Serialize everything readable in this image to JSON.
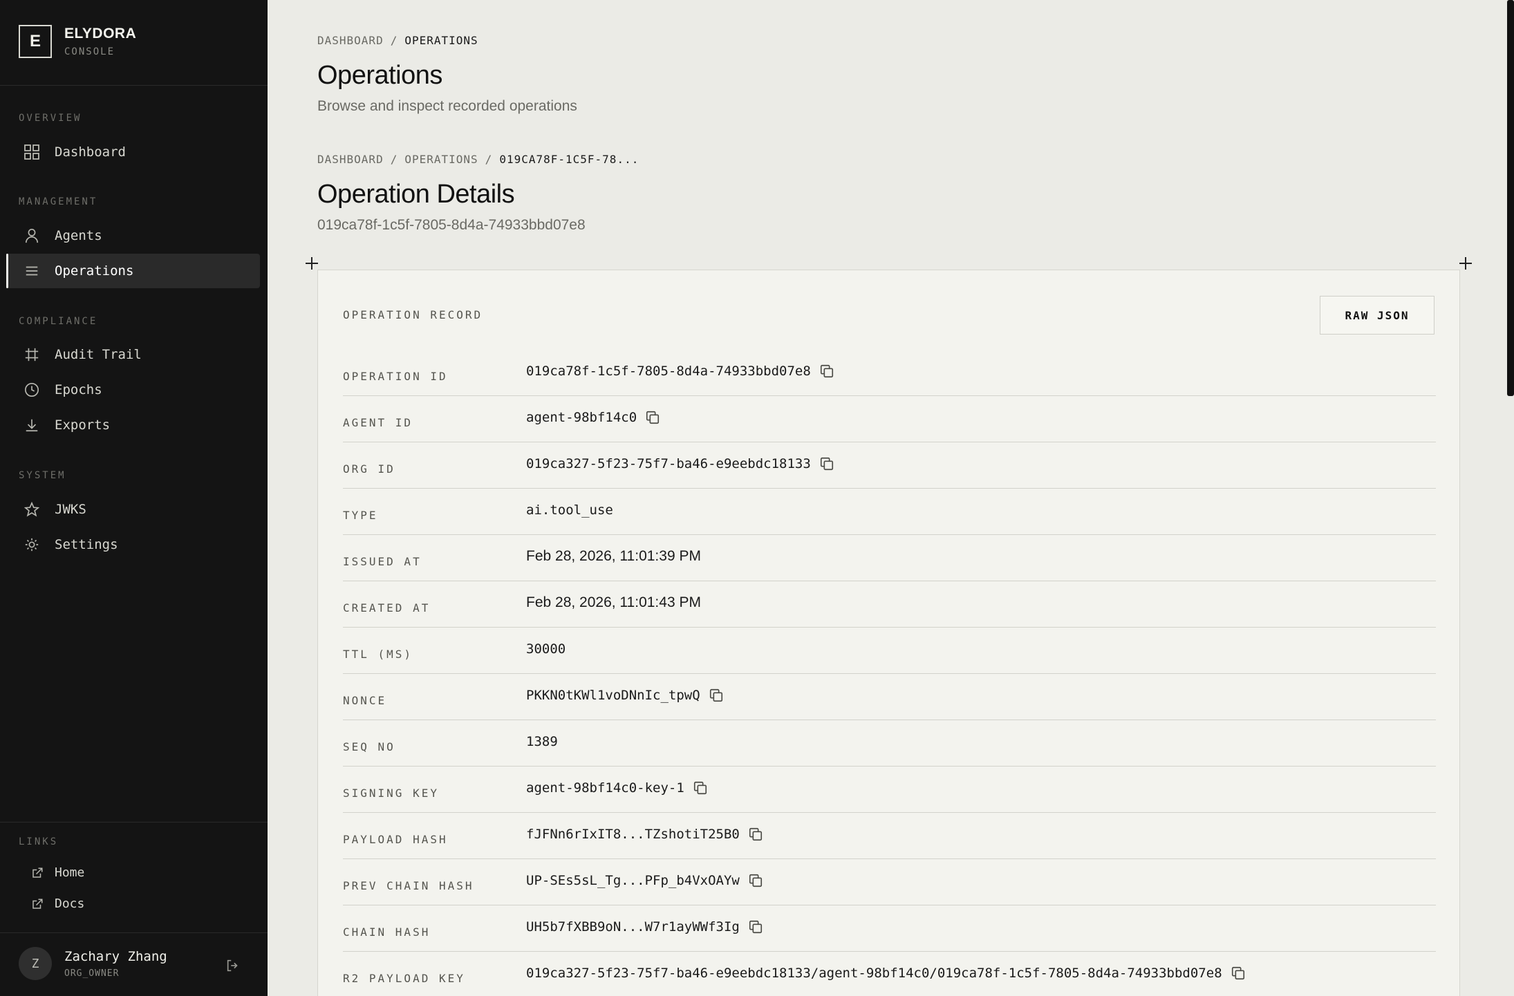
{
  "brand": {
    "logo_letter": "E",
    "name": "ELYDORA",
    "sub": "CONSOLE"
  },
  "sidebar": {
    "sections": [
      {
        "title": "OVERVIEW"
      },
      {
        "title": "MANAGEMENT"
      },
      {
        "title": "COMPLIANCE"
      },
      {
        "title": "SYSTEM"
      },
      {
        "title": "LINKS"
      }
    ],
    "items": {
      "dashboard": {
        "label": "Dashboard",
        "icon": "grid-icon"
      },
      "agents": {
        "label": "Agents",
        "icon": "user-icon"
      },
      "operations": {
        "label": "Operations",
        "icon": "list-icon",
        "active": true
      },
      "audit_trail": {
        "label": "Audit Trail",
        "icon": "hash-icon"
      },
      "epochs": {
        "label": "Epochs",
        "icon": "clock-icon"
      },
      "exports": {
        "label": "Exports",
        "icon": "download-icon"
      },
      "jwks": {
        "label": "JWKS",
        "icon": "star-icon"
      },
      "settings": {
        "label": "Settings",
        "icon": "gear-icon"
      }
    },
    "links": {
      "home": {
        "label": "Home",
        "icon": "external-link-icon"
      },
      "docs": {
        "label": "Docs",
        "icon": "external-link-icon"
      }
    },
    "user": {
      "initial": "Z",
      "name": "Zachary Zhang",
      "role": "ORG_OWNER"
    }
  },
  "header": {
    "breadcrumb1": {
      "root": "DASHBOARD",
      "sep": "/",
      "current": "OPERATIONS"
    },
    "title": "Operations",
    "subtitle": "Browse and inspect recorded operations"
  },
  "detail": {
    "breadcrumb": {
      "root": "DASHBOARD",
      "sep": "/",
      "middle": "OPERATIONS",
      "current": "019CA78F-1C5F-78..."
    },
    "title": "Operation Details",
    "subtitle": "019ca78f-1c5f-7805-8d4a-74933bbd07e8"
  },
  "record": {
    "header": "OPERATION RECORD",
    "raw_button": "RAW JSON",
    "rows": [
      {
        "label": "OPERATION ID",
        "value": "019ca78f-1c5f-7805-8d4a-74933bbd07e8",
        "copy": true,
        "mono": true
      },
      {
        "label": "AGENT ID",
        "value": "agent-98bf14c0",
        "copy": true,
        "mono": true
      },
      {
        "label": "ORG ID",
        "value": "019ca327-5f23-75f7-ba46-e9eebdc18133",
        "copy": true,
        "mono": true
      },
      {
        "label": "TYPE",
        "value": "ai.tool_use",
        "copy": false,
        "mono": true
      },
      {
        "label": "ISSUED AT",
        "value": "Feb 28, 2026, 11:01:39 PM",
        "copy": false,
        "mono": false
      },
      {
        "label": "CREATED AT",
        "value": "Feb 28, 2026, 11:01:43 PM",
        "copy": false,
        "mono": false
      },
      {
        "label": "TTL (MS)",
        "value": "30000",
        "copy": false,
        "mono": true
      },
      {
        "label": "NONCE",
        "value": "PKKN0tKWl1voDNnIc_tpwQ",
        "copy": true,
        "mono": true
      },
      {
        "label": "SEQ NO",
        "value": "1389",
        "copy": false,
        "mono": true
      },
      {
        "label": "SIGNING KEY",
        "value": "agent-98bf14c0-key-1",
        "copy": true,
        "mono": true
      },
      {
        "label": "PAYLOAD HASH",
        "value": "fJFNn6rIxIT8...TZshotiT25B0",
        "copy": true,
        "mono": true
      },
      {
        "label": "PREV CHAIN HASH",
        "value": "UP-SEs5sL_Tg...PFp_b4VxOAYw",
        "copy": true,
        "mono": true
      },
      {
        "label": "CHAIN HASH",
        "value": "UH5b7fXBB9oN...W7r1ayWWf3Ig",
        "copy": true,
        "mono": true
      },
      {
        "label": "R2 PAYLOAD KEY",
        "value": "019ca327-5f23-75f7-ba46-e9eebdc18133/agent-98bf14c0/019ca78f-1c5f-7805-8d4a-74933bbd07e8",
        "copy": true,
        "mono": true
      }
    ]
  }
}
